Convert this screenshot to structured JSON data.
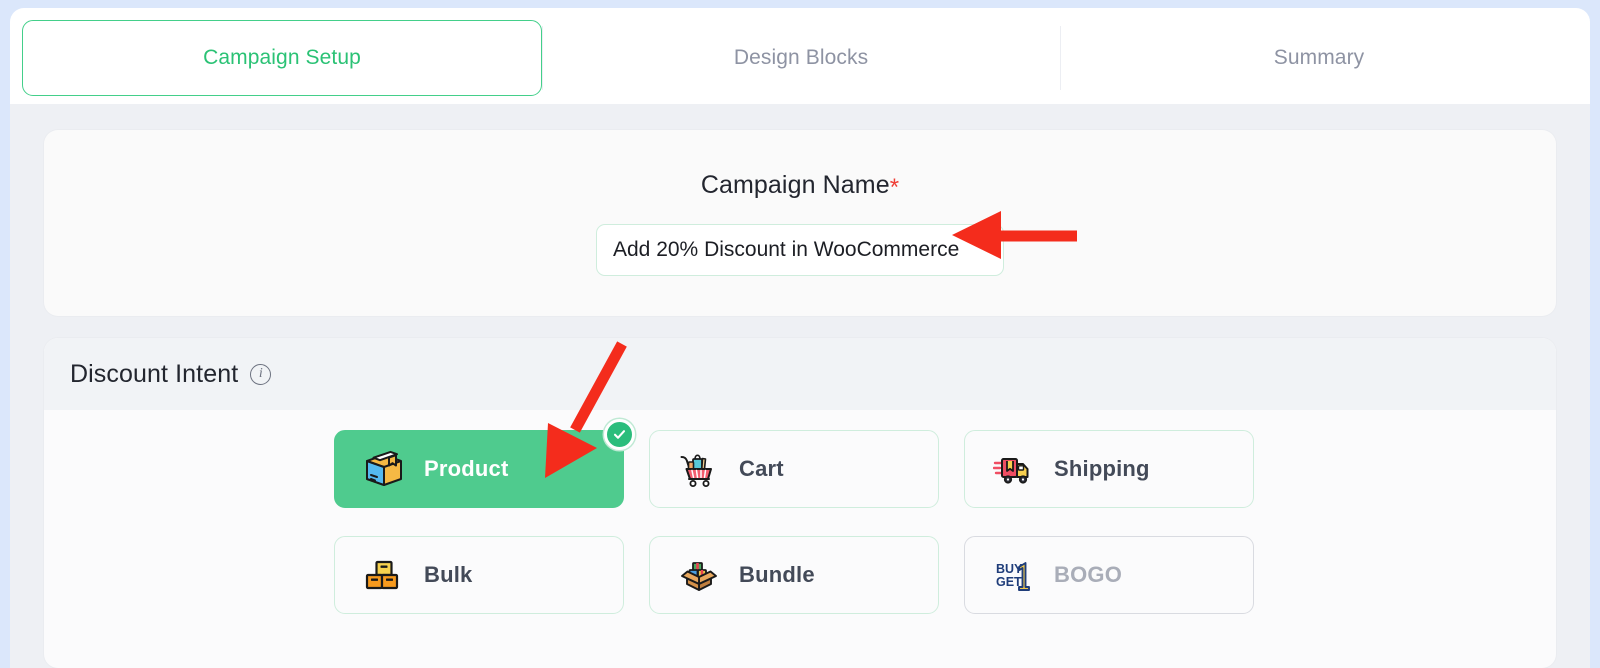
{
  "tabs": [
    {
      "id": "campaign-setup",
      "label": "Campaign Setup",
      "active": true
    },
    {
      "id": "design-blocks",
      "label": "Design Blocks",
      "active": false
    },
    {
      "id": "summary",
      "label": "Summary",
      "active": false
    }
  ],
  "campaign": {
    "label": "Campaign Name",
    "required_marker": "*",
    "value": "Add 20% Discount in WooCommerce",
    "placeholder": "Campaign Name"
  },
  "discount_intent": {
    "title": "Discount Intent",
    "info_glyph": "i",
    "options": [
      {
        "id": "product",
        "label": "Product",
        "icon": "package-box-icon",
        "selected": true,
        "disabled": false
      },
      {
        "id": "cart",
        "label": "Cart",
        "icon": "shopping-cart-icon",
        "selected": false,
        "disabled": false
      },
      {
        "id": "shipping",
        "label": "Shipping",
        "icon": "delivery-truck-icon",
        "selected": false,
        "disabled": false
      },
      {
        "id": "bulk",
        "label": "Bulk",
        "icon": "stacked-boxes-icon",
        "selected": false,
        "disabled": false
      },
      {
        "id": "bundle",
        "label": "Bundle",
        "icon": "open-box-icon",
        "selected": false,
        "disabled": false
      },
      {
        "id": "bogo",
        "label": "BOGO",
        "icon": "buy-one-get-one-icon",
        "selected": false,
        "disabled": true
      }
    ]
  },
  "colors": {
    "accent_green": "#2bc275",
    "selected_green": "#4fcb8e",
    "border_green": "#cfeddd",
    "muted_text": "#8e93a3",
    "annotation_red": "#f42c1c",
    "required_red": "#ef3e36"
  }
}
